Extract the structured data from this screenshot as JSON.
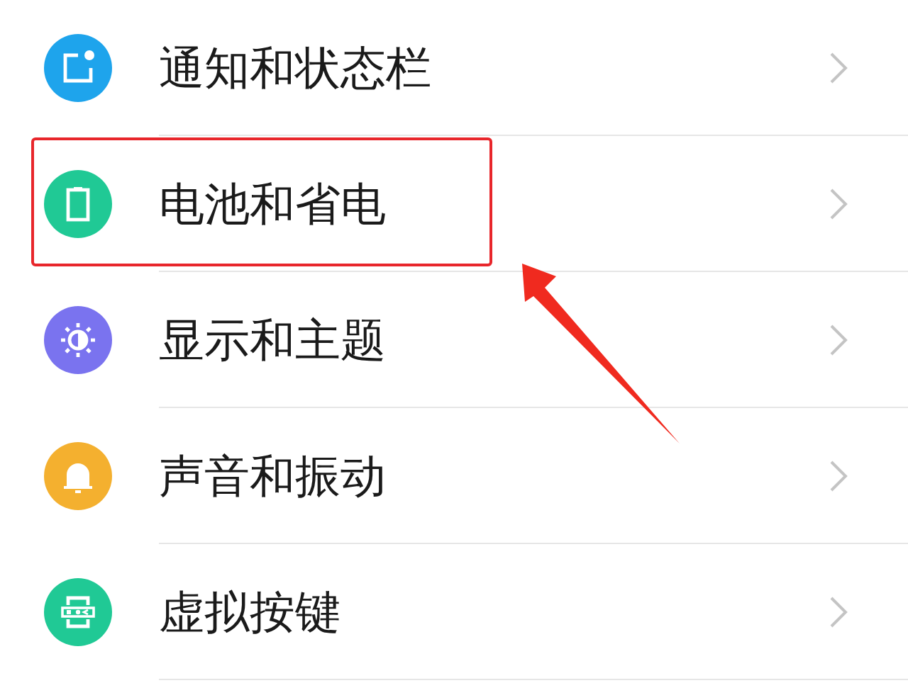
{
  "settings": {
    "items": [
      {
        "label": "通知和状态栏",
        "kind": "notification",
        "color": "#1ea4ec",
        "highlighted": false
      },
      {
        "label": "电池和省电",
        "kind": "battery",
        "color": "#20c995",
        "highlighted": true
      },
      {
        "label": "显示和主题",
        "kind": "display",
        "color": "#7a73ef",
        "highlighted": false
      },
      {
        "label": "声音和振动",
        "kind": "sound",
        "color": "#f4b02f",
        "highlighted": false
      },
      {
        "label": "虚拟按键",
        "kind": "keys",
        "color": "#20c995",
        "highlighted": false
      }
    ]
  }
}
